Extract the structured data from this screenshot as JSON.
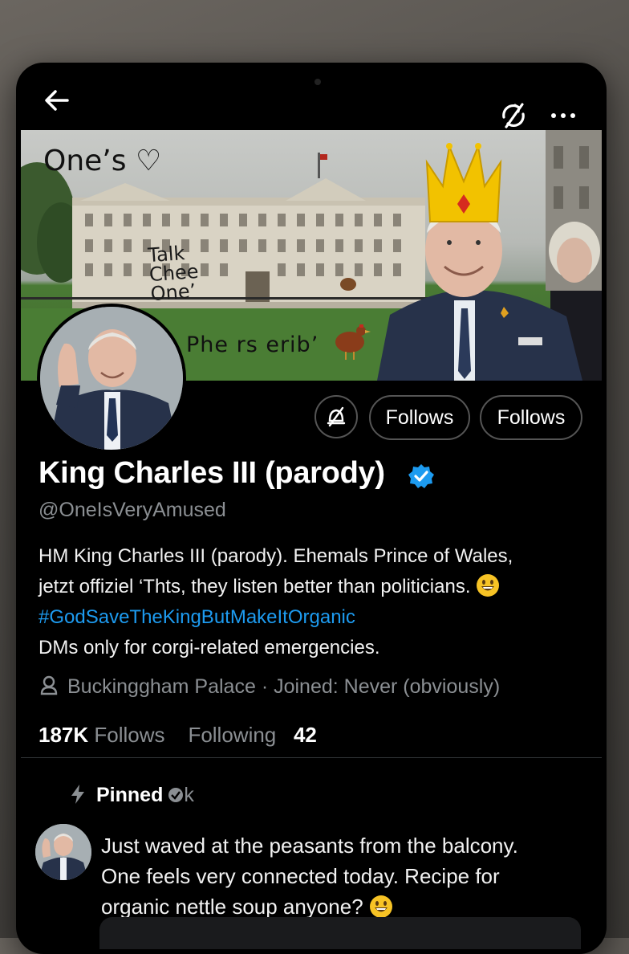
{
  "nav": {
    "back_icon": "arrow-left-icon",
    "sync_icon": "slashed-sync-icon",
    "more_icon": "more-horizontal-icon",
    "more_label": "•••"
  },
  "banner": {
    "scribble_top": "One’s ♡",
    "scribble_middle": [
      "Talk",
      "Chee",
      "One’"
    ],
    "scribble_bottom": "Phe rs erib’"
  },
  "profile": {
    "name": "King Charles III (parody)",
    "verified": true,
    "handle": "@OneIsVeryAmused",
    "follows_button_1": "Follows",
    "follows_button_2": "Follows",
    "bio_line1": "HM King Charles III (parody). Ehemals Prince of Wales,",
    "bio_line2": "jetzt offiziel ‘Thts, they listen better than politicians.",
    "hashtag": "#GodSaveTheKingButMakeItOrganic",
    "bio_line4": "DMs only for corgi-related emergencies.",
    "location": "Buckinggham Palace",
    "joined": "· Joined: Never (obviously)",
    "followers_count": "187K",
    "followers_label": "Follows",
    "following_label": "Following",
    "following_count": "42"
  },
  "pinned": {
    "label": "Pinned",
    "suffix": "k",
    "text_line1": "Just waved at the peasants from the balcony.",
    "text_line2": "One feels very connected today. Recipe for",
    "text_line3": "organic nettle soup anyone?"
  },
  "colors": {
    "accent": "#1d9bf0",
    "background": "#000000",
    "secondary_text": "#8b8f93",
    "crown": "#f2c200"
  }
}
